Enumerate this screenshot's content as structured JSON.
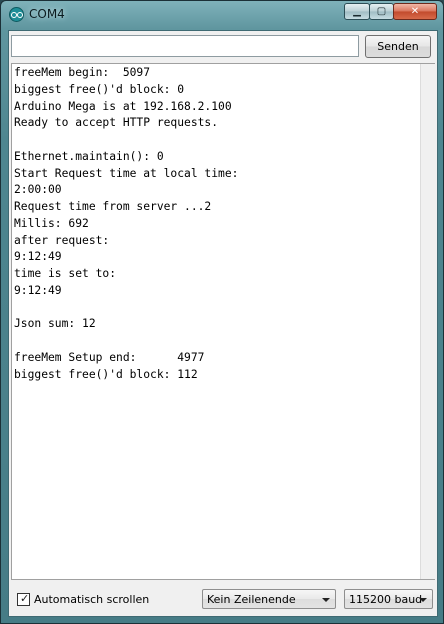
{
  "window": {
    "title": "COM4",
    "controls": {
      "minimize": "▁",
      "maximize": "▢",
      "close": "✕"
    }
  },
  "send": {
    "input_value": "",
    "button_label": "Senden"
  },
  "output": {
    "lines": [
      "freeMem begin:  5097",
      "biggest free()'d block: 0",
      "Arduino Mega is at 192.168.2.100",
      "Ready to accept HTTP requests.",
      "",
      "Ethernet.maintain(): 0",
      "Start Request time at local time:",
      "2:00:00",
      "Request time from server ...2",
      "Millis: 692",
      "after request:",
      "9:12:49",
      "time is set to:",
      "9:12:49",
      "",
      "Json sum: 12",
      "",
      "freeMem Setup end:      4977",
      "biggest free()'d block: 112"
    ]
  },
  "bottom": {
    "autoscroll_label": "Automatisch scrollen",
    "autoscroll_checked": true,
    "line_ending": "Kein Zeilenende",
    "baud": "115200 baud"
  },
  "icons": {
    "app": "arduino-icon",
    "check": "✓"
  }
}
